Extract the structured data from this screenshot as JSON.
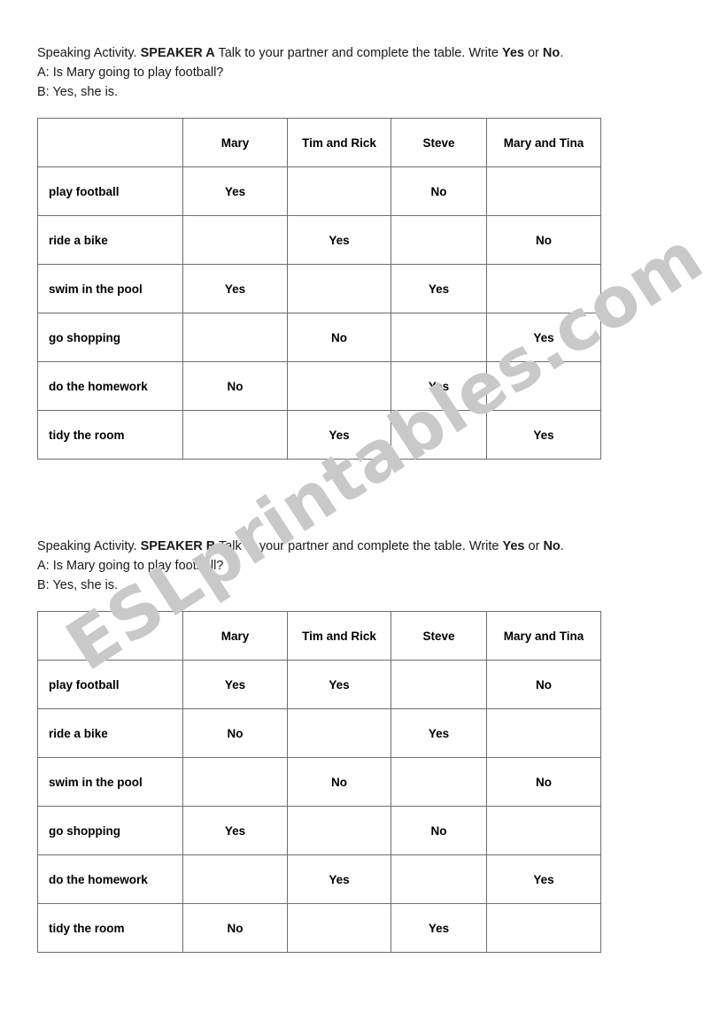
{
  "document": {
    "watermark": "ESLprintables.com",
    "watermark_color": "#c9c9c9",
    "border_color": "#6e6e6e",
    "text_color": "#1a1a1a"
  },
  "sections": [
    {
      "id": "speaker-a",
      "intro_prefix": "Speaking Activity. ",
      "intro_speaker": "SPEAKER A",
      "intro_middle": " Talk to your partner and complete the table. Write ",
      "intro_yes": "Yes",
      "intro_or": " or ",
      "intro_no": "No",
      "intro_end": ".",
      "dialog_a": "A: Is Mary going to play football?",
      "dialog_b": "B: Yes, she is.",
      "table": {
        "headers": [
          "",
          "Mary",
          "Tim and Rick",
          "Steve",
          "Mary and Tina"
        ],
        "rows": [
          {
            "label": "play football",
            "cells": [
              "Yes",
              "",
              "No",
              ""
            ]
          },
          {
            "label": "ride a bike",
            "cells": [
              "",
              "Yes",
              "",
              "No"
            ]
          },
          {
            "label": "swim in the pool",
            "cells": [
              "Yes",
              "",
              "Yes",
              ""
            ]
          },
          {
            "label": "go shopping",
            "cells": [
              "",
              "No",
              "",
              "Yes"
            ]
          },
          {
            "label": "do the homework",
            "cells": [
              "No",
              "",
              "Yes",
              ""
            ]
          },
          {
            "label": "tidy the room",
            "cells": [
              "",
              "Yes",
              "",
              "Yes"
            ]
          }
        ]
      }
    },
    {
      "id": "speaker-b",
      "intro_prefix": "Speaking Activity. ",
      "intro_speaker": "SPEAKER B",
      "intro_middle": " Talk to your partner and complete the table. Write ",
      "intro_yes": "Yes",
      "intro_or": " or ",
      "intro_no": "No",
      "intro_end": ".",
      "dialog_a": "A: Is Mary going to play football?",
      "dialog_b": "B: Yes, she is.",
      "table": {
        "headers": [
          "",
          "Mary",
          "Tim and Rick",
          "Steve",
          "Mary and Tina"
        ],
        "rows": [
          {
            "label": "play football",
            "cells": [
              "Yes",
              "Yes",
              "",
              "No"
            ]
          },
          {
            "label": "ride a bike",
            "cells": [
              "No",
              "",
              "Yes",
              ""
            ]
          },
          {
            "label": "swim in the pool",
            "cells": [
              "",
              "No",
              "",
              "No"
            ]
          },
          {
            "label": "go shopping",
            "cells": [
              "Yes",
              "",
              "No",
              ""
            ]
          },
          {
            "label": "do the homework",
            "cells": [
              "",
              "Yes",
              "",
              "Yes"
            ]
          },
          {
            "label": "tidy the room",
            "cells": [
              "No",
              "",
              "Yes",
              ""
            ]
          }
        ]
      }
    }
  ]
}
